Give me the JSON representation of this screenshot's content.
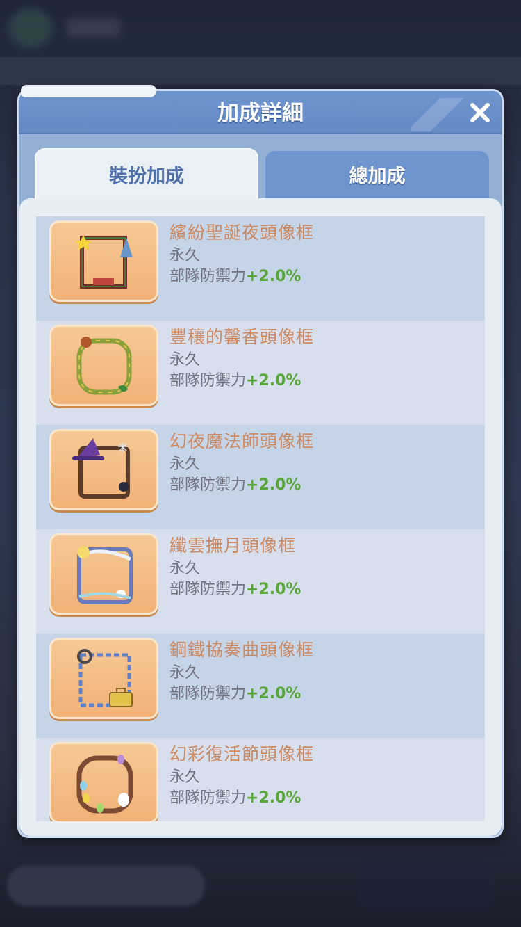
{
  "dialog": {
    "title": "加成詳細",
    "close_icon": "close-icon"
  },
  "tabs": [
    {
      "label": "裝扮加成",
      "active": true
    },
    {
      "label": "總加成",
      "active": false
    }
  ],
  "items": [
    {
      "name": "繽紛聖誕夜頭像框",
      "duration": "永久",
      "bonus_label": "部隊防禦力",
      "bonus_value": "+2.0%",
      "icon": "christmas-frame-icon"
    },
    {
      "name": "豐穰的馨香頭像框",
      "duration": "永久",
      "bonus_label": "部隊防禦力",
      "bonus_value": "+2.0%",
      "icon": "harvest-wreath-frame-icon"
    },
    {
      "name": "幻夜魔法師頭像框",
      "duration": "永久",
      "bonus_label": "部隊防禦力",
      "bonus_value": "+2.0%",
      "icon": "witch-hat-frame-icon"
    },
    {
      "name": "纖雲撫月頭像框",
      "duration": "永久",
      "bonus_label": "部隊防禦力",
      "bonus_value": "+2.0%",
      "icon": "moon-rabbit-frame-icon"
    },
    {
      "name": "鋼鐵協奏曲頭像框",
      "duration": "永久",
      "bonus_label": "部隊防禦力",
      "bonus_value": "+2.0%",
      "icon": "steel-toolbox-frame-icon"
    },
    {
      "name": "幻彩復活節頭像框",
      "duration": "永久",
      "bonus_label": "部隊防禦力",
      "bonus_value": "+2.0%",
      "icon": "easter-egg-frame-icon"
    }
  ],
  "colors": {
    "header": "#6f95cf",
    "item_name": "#cd8a62",
    "bonus_value": "#5aa53c"
  }
}
